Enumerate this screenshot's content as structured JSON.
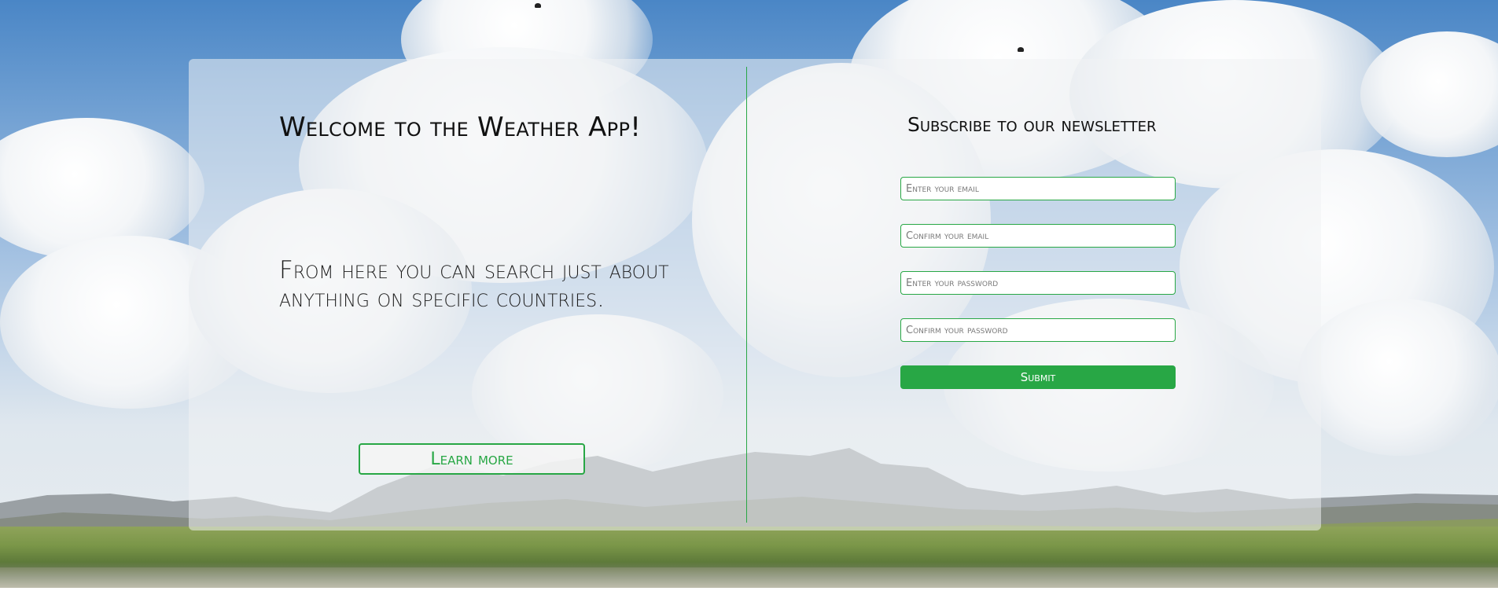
{
  "hero": {
    "title": "Welcome to the Weather App!",
    "description": "From here you can search just about anything on specific countries.",
    "learn_more_label": "Learn more"
  },
  "newsletter": {
    "title": "Subscribe to our newsletter",
    "email_placeholder": "Enter your email",
    "confirm_email_placeholder": "Confirm your email",
    "password_placeholder": "Enter your password",
    "confirm_password_placeholder": "Confirm your password",
    "submit_label": "Submit"
  },
  "theme": {
    "accent": "#28a745",
    "card_background": "rgba(240,242,244,0.55)"
  }
}
